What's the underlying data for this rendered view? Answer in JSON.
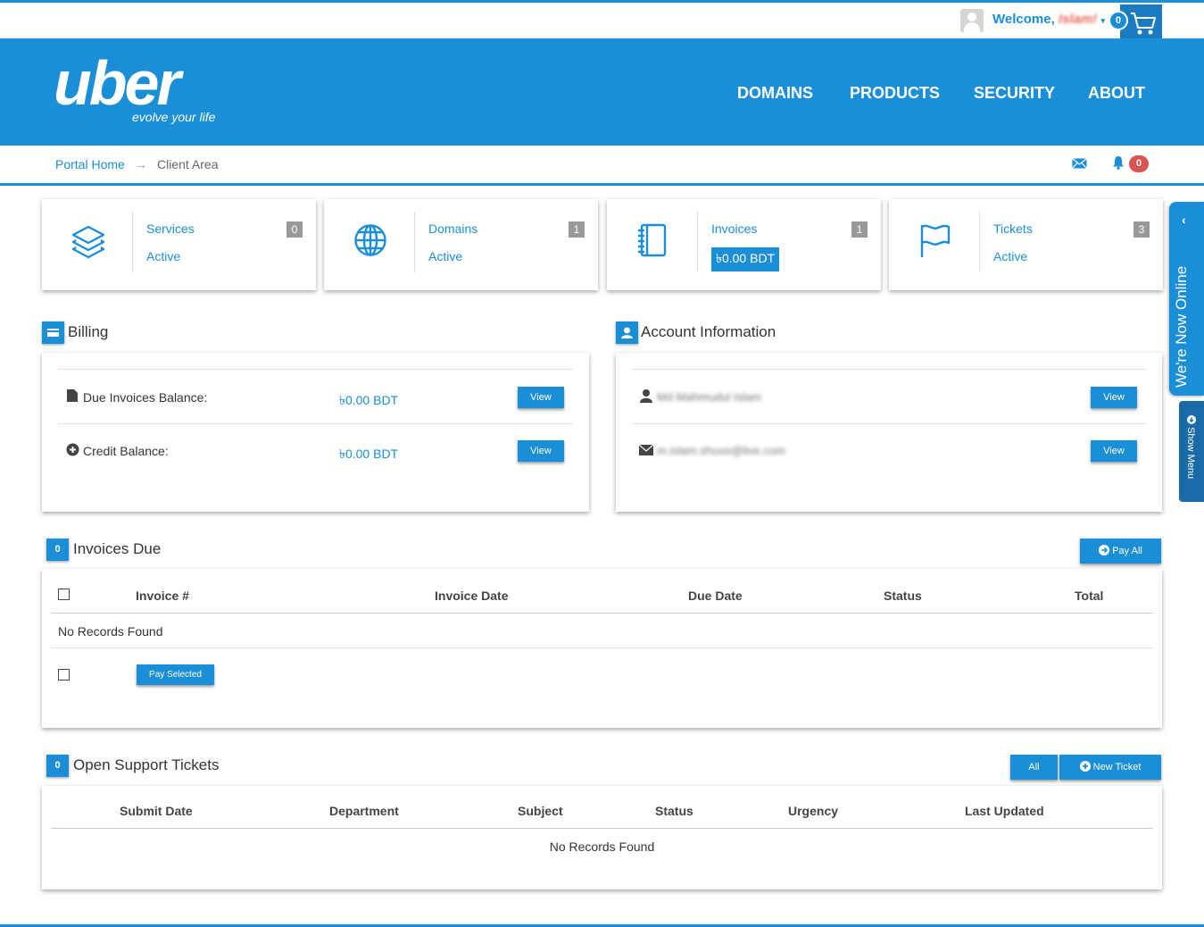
{
  "user": {
    "welcome": "Welcome,",
    "name": "Islam!",
    "caret": "▾"
  },
  "cart": {
    "count": "0"
  },
  "logo": {
    "word": "uber",
    "tagline": "evolve your life"
  },
  "nav": [
    "DOMAINS",
    "PRODUCTS",
    "SECURITY",
    "ABOUT"
  ],
  "breadcrumb": {
    "home": "Portal Home",
    "separator": "→",
    "current": "Client Area"
  },
  "notifications": {
    "count": "0"
  },
  "tiles": [
    {
      "icon": "layers-icon",
      "label": "Services",
      "sub": "Active",
      "count": "0"
    },
    {
      "icon": "globe-icon",
      "label": "Domains",
      "sub": "Active",
      "count": "1"
    },
    {
      "icon": "notebook-icon",
      "label": "Invoices",
      "sub": "৳0.00 BDT",
      "count": "1"
    },
    {
      "icon": "flag-icon",
      "label": "Tickets",
      "sub": "Active",
      "count": "3"
    }
  ],
  "billing": {
    "title": "Billing",
    "due_label": "Due Invoices Balance:",
    "due_value": "৳0.00 BDT",
    "credit_label": "Credit Balance:",
    "credit_value": "৳0.00 BDT",
    "view_label": "View"
  },
  "account": {
    "title": "Account Information",
    "name": "Md Mahmudul Islam",
    "email": "m.islam.shuvo@live.com",
    "view_label": "View"
  },
  "invoices_due": {
    "count": "0",
    "title": "Invoices Due",
    "pay_all": "Pay All",
    "columns": [
      "Invoice #",
      "Invoice Date",
      "Due Date",
      "Status",
      "Total"
    ],
    "empty": "No Records Found",
    "pay_selected": "Pay Selected"
  },
  "tickets": {
    "count": "0",
    "title": "Open Support Tickets",
    "all_label": "All",
    "new_ticket": "New Ticket",
    "columns": [
      "Submit Date",
      "Department",
      "Subject",
      "Status",
      "Urgency",
      "Last Updated"
    ],
    "empty": "No Records Found"
  },
  "live_chat": {
    "text": "We're Now Online",
    "chevron": "‹"
  },
  "show_menu": {
    "text": "Show Menu"
  },
  "colors": {
    "primary": "#1a8ed6",
    "danger": "#d9534f",
    "badge_gray": "#999999"
  }
}
